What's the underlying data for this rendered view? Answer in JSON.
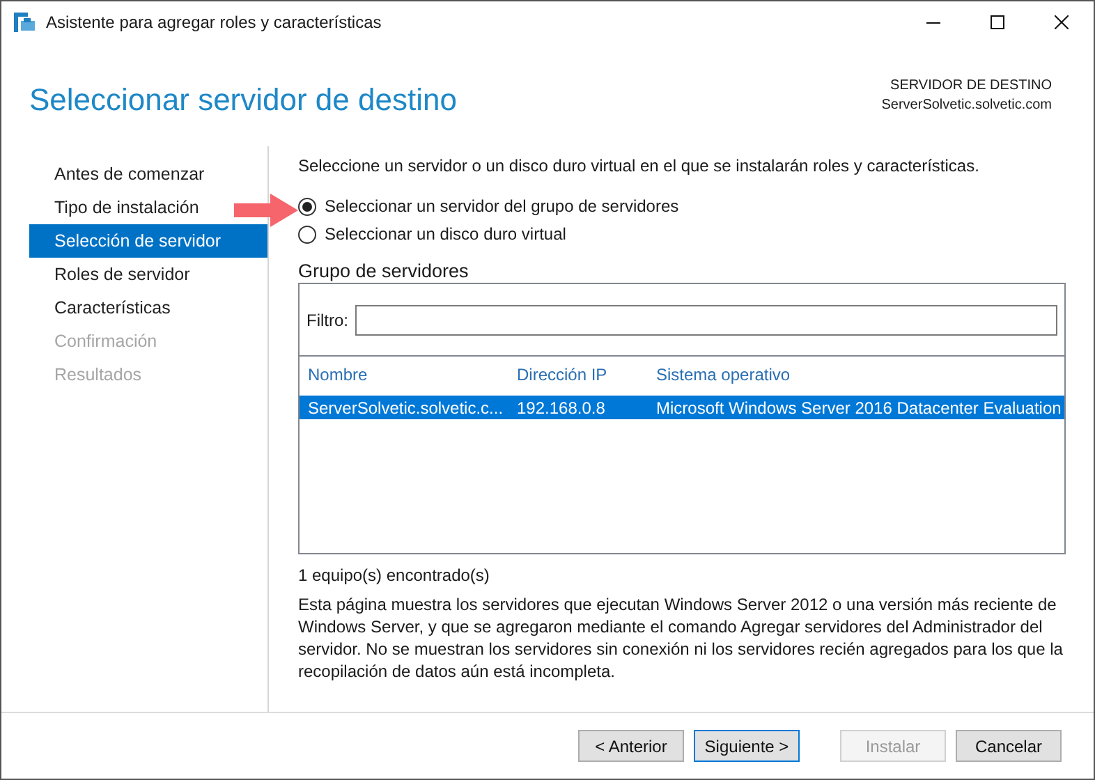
{
  "window": {
    "title": "Asistente para agregar roles y características"
  },
  "header": {
    "title": "Seleccionar servidor de destino",
    "destination_label": "SERVIDOR DE DESTINO",
    "destination_server": "ServerSolvetic.solvetic.com"
  },
  "sidebar": {
    "items": [
      {
        "label": "Antes de comenzar",
        "selected": false,
        "disabled": false
      },
      {
        "label": "Tipo de instalación",
        "selected": false,
        "disabled": false
      },
      {
        "label": "Selección de servidor",
        "selected": true,
        "disabled": false
      },
      {
        "label": "Roles de servidor",
        "selected": false,
        "disabled": false
      },
      {
        "label": "Características",
        "selected": false,
        "disabled": false
      },
      {
        "label": "Confirmación",
        "selected": false,
        "disabled": true
      },
      {
        "label": "Resultados",
        "selected": false,
        "disabled": true
      }
    ]
  },
  "content": {
    "instruction": "Seleccione un servidor o un disco duro virtual en el que se instalarán roles y características.",
    "options": [
      {
        "label": "Seleccionar un servidor del grupo de servidores",
        "selected": true
      },
      {
        "label": "Seleccionar un disco duro virtual",
        "selected": false
      }
    ],
    "group": {
      "title": "Grupo de servidores",
      "filter": {
        "label": "Filtro:"
      },
      "table": {
        "columns": [
          "Nombre",
          "Dirección IP",
          "Sistema operativo"
        ],
        "rows": [
          {
            "cells": [
              "ServerSolvetic.solvetic.c...",
              "192.168.0.8",
              "Microsoft Windows Server 2016 Datacenter Evaluation"
            ],
            "selected": true
          }
        ]
      }
    },
    "count": "1 equipo(s) encontrado(s)",
    "description": "Esta página muestra los servidores que ejecutan Windows Server 2012 o una versión más reciente de Windows Server, y que se agregaron mediante el comando Agregar servidores del Administrador del servidor. No se muestran los servidores sin conexión ni los servidores recién agregados para los que la recopilación de datos aún está incompleta."
  },
  "buttons": [
    {
      "label": "< Anterior",
      "disabled": false,
      "default": false
    },
    {
      "label": "Siguiente >",
      "disabled": false,
      "default": true
    },
    {
      "label": "Instalar",
      "disabled": true,
      "default": false
    },
    {
      "label": "Cancelar",
      "disabled": false,
      "default": false
    }
  ]
}
